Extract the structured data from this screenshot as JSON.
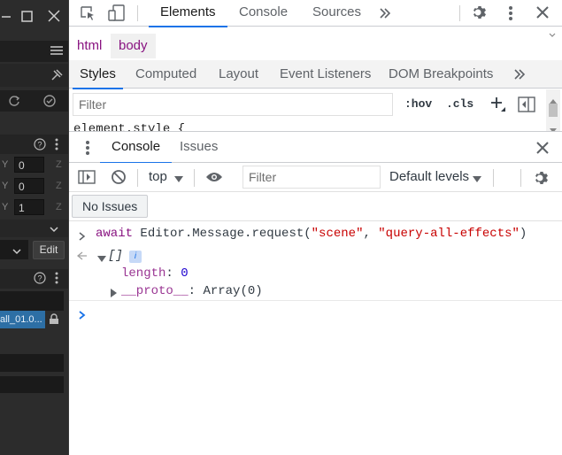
{
  "left_panel": {
    "row_inputs": [
      {
        "axis": "Y",
        "value": "0",
        "z": "Z"
      },
      {
        "axis": "Y",
        "value": "0",
        "z": "Z"
      },
      {
        "axis": "Y",
        "value": "1",
        "z": "Z"
      }
    ],
    "edit_label": "Edit",
    "asset_label": "all_01.0..."
  },
  "devtools": {
    "main_tabs": [
      "Elements",
      "Console",
      "Sources"
    ],
    "active_main_tab": "Elements",
    "breadcrumbs": [
      "html",
      "body"
    ],
    "style_tabs": [
      "Styles",
      "Computed",
      "Layout",
      "Event Listeners",
      "DOM Breakpoints"
    ],
    "active_style_tab": "Styles",
    "styles_filter_placeholder": "Filter",
    "hov_label": ":hov",
    "cls_label": ".cls",
    "element_style_text": "element.style {",
    "drawer_tabs": [
      "Console",
      "Issues"
    ],
    "active_drawer_tab": "Console",
    "context_label": "top",
    "console_filter_placeholder": "Filter",
    "levels_label": "Default levels",
    "no_issues_label": "No Issues"
  },
  "console": {
    "input": {
      "keyword": "await",
      "expr_start": " Editor.Message.request(",
      "arg1": "\"scene\"",
      "sep": ", ",
      "arg2": "\"query-all-effects\"",
      "expr_end": ")"
    },
    "result": {
      "array_label": "[]",
      "length_key": "length",
      "length_value": "0",
      "proto_key": "__proto__",
      "proto_value": "Array(0)"
    }
  },
  "colors": {
    "accent": "#1a73e8",
    "tag_purple": "#881280",
    "string_red": "#c80000",
    "number_blue": "#1c00cf",
    "editor_dark": "#2c2c2c"
  }
}
